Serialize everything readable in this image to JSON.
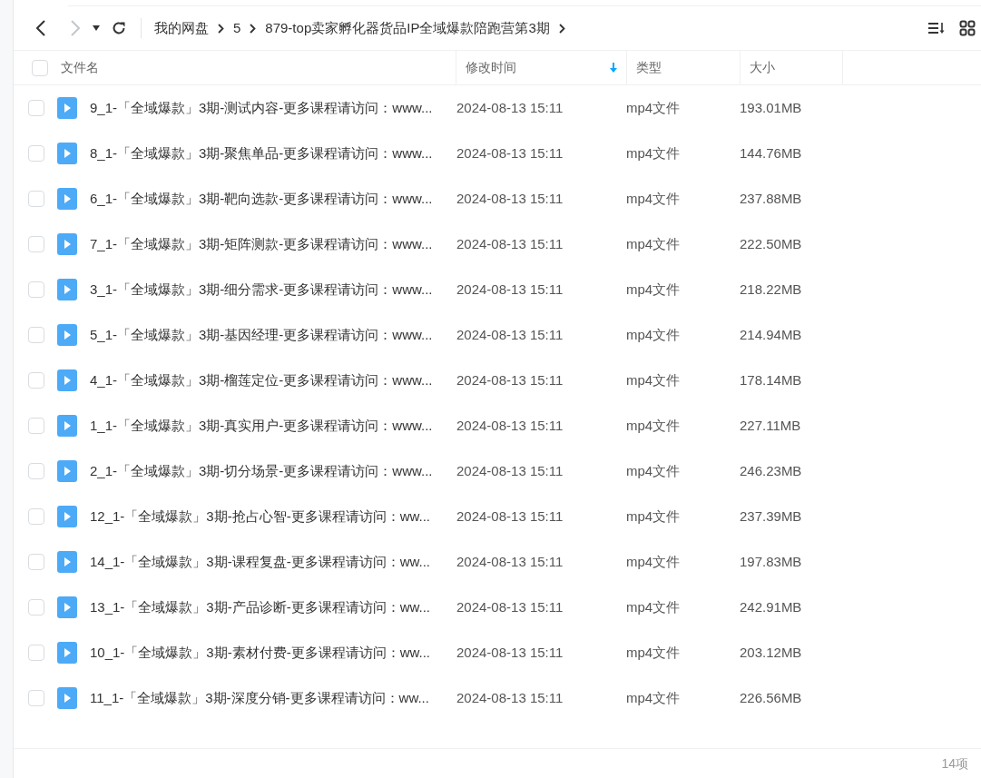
{
  "toolbar": {
    "breadcrumbs": [
      "我的网盘",
      "5",
      "879-top卖家孵化器货品IP全域爆款陪跑营第3期"
    ]
  },
  "table": {
    "select_all": {
      "checked": false
    },
    "columns": [
      {
        "label": "文件名",
        "sorted": false
      },
      {
        "label": "修改时间",
        "sorted": true
      },
      {
        "label": "类型",
        "sorted": false
      },
      {
        "label": "大小",
        "sorted": false
      }
    ],
    "rows": [
      {
        "name": "9_1-「全域爆款」3期-测试内容-更多课程请访问：www...",
        "modified": "2024-08-13 15:11",
        "type": "mp4文件",
        "size": "193.01MB",
        "checked": false
      },
      {
        "name": "8_1-「全域爆款」3期-聚焦单品-更多课程请访问：www...",
        "modified": "2024-08-13 15:11",
        "type": "mp4文件",
        "size": "144.76MB",
        "checked": false
      },
      {
        "name": "6_1-「全域爆款」3期-靶向选款-更多课程请访问：www...",
        "modified": "2024-08-13 15:11",
        "type": "mp4文件",
        "size": "237.88MB",
        "checked": false
      },
      {
        "name": "7_1-「全域爆款」3期-矩阵测款-更多课程请访问：www...",
        "modified": "2024-08-13 15:11",
        "type": "mp4文件",
        "size": "222.50MB",
        "checked": false
      },
      {
        "name": "3_1-「全域爆款」3期-细分需求-更多课程请访问：www...",
        "modified": "2024-08-13 15:11",
        "type": "mp4文件",
        "size": "218.22MB",
        "checked": false
      },
      {
        "name": "5_1-「全域爆款」3期-基因经理-更多课程请访问：www...",
        "modified": "2024-08-13 15:11",
        "type": "mp4文件",
        "size": "214.94MB",
        "checked": false
      },
      {
        "name": "4_1-「全域爆款」3期-榴莲定位-更多课程请访问：www...",
        "modified": "2024-08-13 15:11",
        "type": "mp4文件",
        "size": "178.14MB",
        "checked": false
      },
      {
        "name": "1_1-「全域爆款」3期-真实用户-更多课程请访问：www...",
        "modified": "2024-08-13 15:11",
        "type": "mp4文件",
        "size": "227.11MB",
        "checked": false
      },
      {
        "name": "2_1-「全域爆款」3期-切分场景-更多课程请访问：www...",
        "modified": "2024-08-13 15:11",
        "type": "mp4文件",
        "size": "246.23MB",
        "checked": false
      },
      {
        "name": "12_1-「全域爆款」3期-抢占心智-更多课程请访问：ww...",
        "modified": "2024-08-13 15:11",
        "type": "mp4文件",
        "size": "237.39MB",
        "checked": false
      },
      {
        "name": "14_1-「全域爆款」3期-课程复盘-更多课程请访问：ww...",
        "modified": "2024-08-13 15:11",
        "type": "mp4文件",
        "size": "197.83MB",
        "checked": false
      },
      {
        "name": "13_1-「全域爆款」3期-产品诊断-更多课程请访问：ww...",
        "modified": "2024-08-13 15:11",
        "type": "mp4文件",
        "size": "242.91MB",
        "checked": false
      },
      {
        "name": "10_1-「全域爆款」3期-素材付费-更多课程请访问：ww...",
        "modified": "2024-08-13 15:11",
        "type": "mp4文件",
        "size": "203.12MB",
        "checked": false
      },
      {
        "name": "11_1-「全域爆款」3期-深度分销-更多课程请访问：ww...",
        "modified": "2024-08-13 15:11",
        "type": "mp4文件",
        "size": "226.56MB",
        "checked": false
      }
    ]
  },
  "status_bar": {
    "count": "14项"
  }
}
